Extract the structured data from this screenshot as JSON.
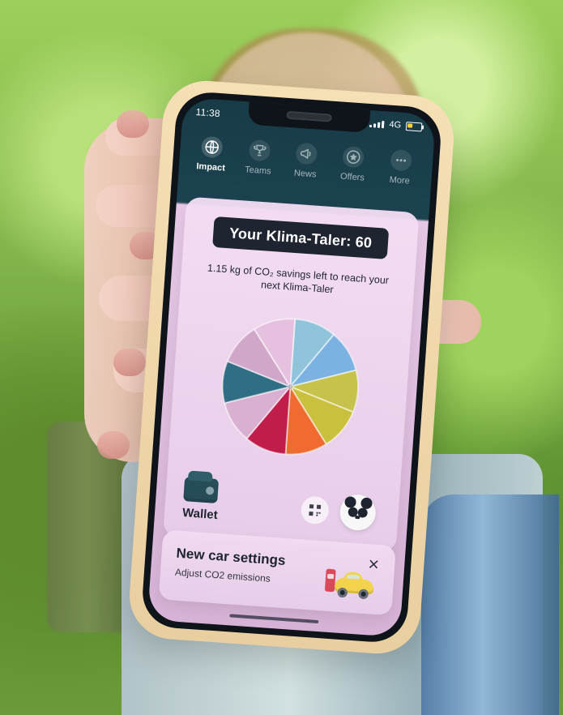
{
  "status": {
    "time": "11:38",
    "network": "4G"
  },
  "nav": {
    "items": [
      {
        "label": "Impact",
        "icon": "globe-icon",
        "active": true
      },
      {
        "label": "Teams",
        "icon": "trophy-icon",
        "active": false
      },
      {
        "label": "News",
        "icon": "megaphone-icon",
        "active": false
      },
      {
        "label": "Offers",
        "icon": "star-icon",
        "active": false
      },
      {
        "label": "More",
        "icon": "more-dots-icon",
        "active": false
      }
    ]
  },
  "main": {
    "klima_taler_label": "Your Klima-Taler: 60",
    "savings_text": "1.15 kg of CO₂ savings left to reach your next Klima-Taler",
    "wallet_label": "Wallet"
  },
  "bottom_card": {
    "title": "New car settings",
    "subtitle": "Adjust CO2 emissions",
    "close_label": "×"
  },
  "pie": {
    "segments": [
      {
        "color": "#8fc4db",
        "value": 1
      },
      {
        "color": "#7bb2e2",
        "value": 1
      },
      {
        "color": "#c6c24b",
        "value": 1
      },
      {
        "color": "#c9c03e",
        "value": 1
      },
      {
        "color": "#f06b2f",
        "value": 1
      },
      {
        "color": "#c11d4a",
        "value": 1
      },
      {
        "color": "#d9b0d2",
        "value": 1
      },
      {
        "color": "#2f6e84",
        "value": 1
      },
      {
        "color": "#d0a7c9",
        "value": 1
      },
      {
        "color": "#e6c1df",
        "value": 1
      }
    ]
  }
}
